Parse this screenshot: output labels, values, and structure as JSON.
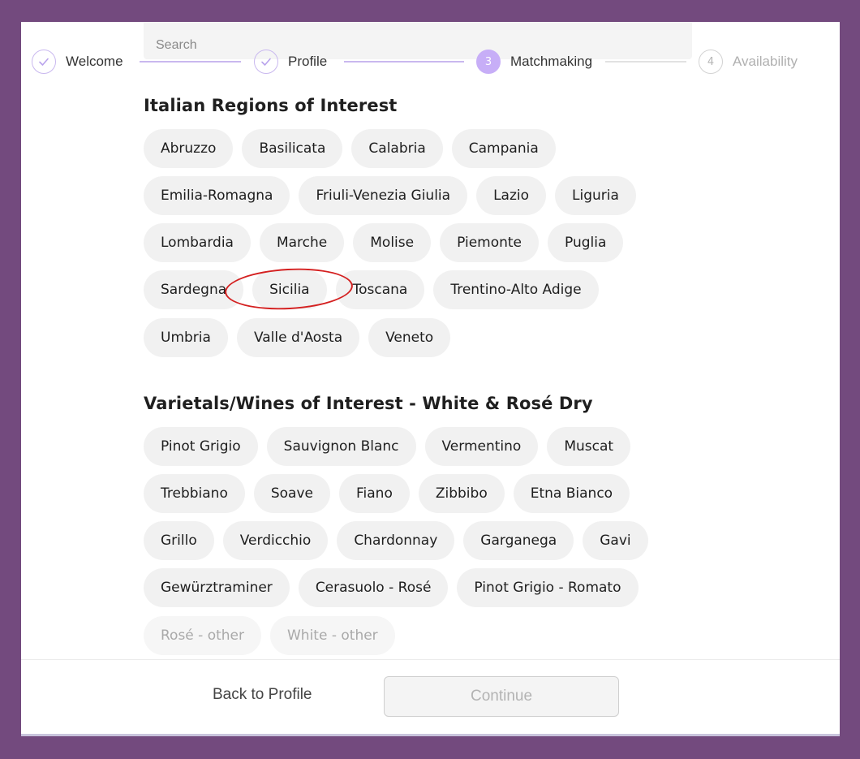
{
  "search": {
    "placeholder": "Search",
    "value": ""
  },
  "stepper": {
    "steps": [
      {
        "label": "Welcome",
        "state": "done",
        "number": ""
      },
      {
        "label": "Profile",
        "state": "done",
        "number": ""
      },
      {
        "label": "Matchmaking",
        "state": "active",
        "number": "3"
      },
      {
        "label": "Availability",
        "state": "pending",
        "number": "4"
      }
    ]
  },
  "regions": {
    "title": "Italian Regions of Interest",
    "chips": [
      "Abruzzo",
      "Basilicata",
      "Calabria",
      "Campania",
      "Emilia-Romagna",
      "Friuli-Venezia Giulia",
      "Lazio",
      "Liguria",
      "Lombardia",
      "Marche",
      "Molise",
      "Piemonte",
      "Puglia",
      "Sardegna",
      "Sicilia",
      "Toscana",
      "Trentino-Alto Adige",
      "Umbria",
      "Valle d'Aosta",
      "Veneto"
    ]
  },
  "varietals": {
    "title": "Varietals/Wines of Interest - White & Rosé Dry",
    "chips": [
      "Pinot Grigio",
      "Sauvignon Blanc",
      "Vermentino",
      "Muscat",
      "Trebbiano",
      "Soave",
      "Fiano",
      "Zibbibo",
      "Etna Bianco",
      "Grillo",
      "Verdicchio",
      "Chardonnay",
      "Garganega",
      "Gavi",
      "Gewürztraminer",
      "Cerasuolo - Rosé",
      "Pinot Grigio - Romato",
      "Rosé - other",
      "White - other"
    ]
  },
  "footer": {
    "back_label": "Back to Profile",
    "continue_label": "Continue"
  },
  "colors": {
    "frame": "#734a7e",
    "accent": "#c7aef7",
    "annotation": "#d42020"
  }
}
